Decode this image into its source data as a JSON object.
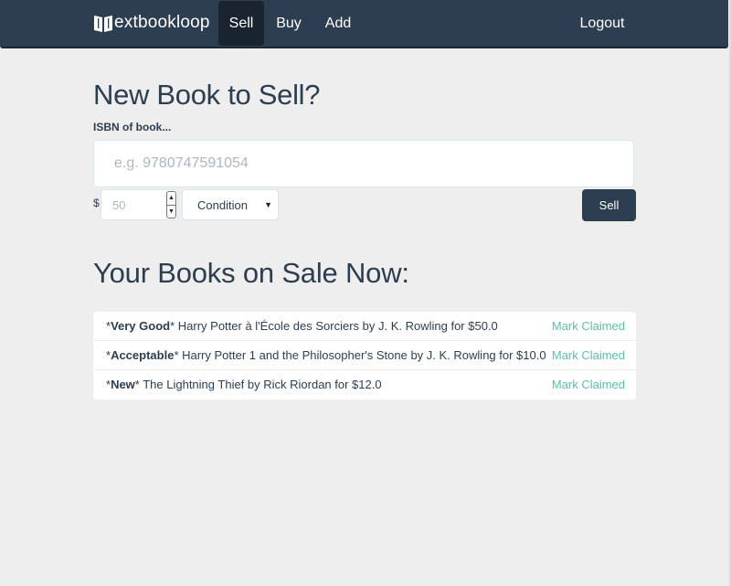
{
  "nav": {
    "brand": "extbookloop",
    "brand_icon": "book-icon",
    "items": [
      {
        "label": "Sell",
        "active": true
      },
      {
        "label": "Buy",
        "active": false
      },
      {
        "label": "Add",
        "active": false
      }
    ],
    "logout": "Logout"
  },
  "sell_form": {
    "title": "New Book to Sell?",
    "isbn_label": "ISBN of book...",
    "isbn_placeholder": "e.g. 9780747591054",
    "isbn_value": "",
    "currency_symbol": "$",
    "price_placeholder": "50",
    "spin_up": "▲",
    "spin_down": "▼",
    "condition_selected": "Condition",
    "condition_caret": "▼",
    "submit_label": "Sell"
  },
  "listings": {
    "title": "Your Books on Sale Now:",
    "action_label": "Mark Claimed",
    "items": [
      {
        "condition": "Very Good",
        "description": "Harry Potter à l'École des Sorciers by J. K. Rowling for $50.0"
      },
      {
        "condition": "Acceptable",
        "description": "Harry Potter 1 and the Philosopher's Stone by J. K. Rowling for $10.0"
      },
      {
        "condition": "New",
        "description": "The Lightning Thief by Rick Riordan for $12.0"
      }
    ]
  },
  "colors": {
    "navbar": "#2c3e50",
    "nav_active": "#1a242f",
    "accent_link": "#5dbfa8",
    "page_bg": "#eeeeee",
    "text": "#2c3e50"
  }
}
